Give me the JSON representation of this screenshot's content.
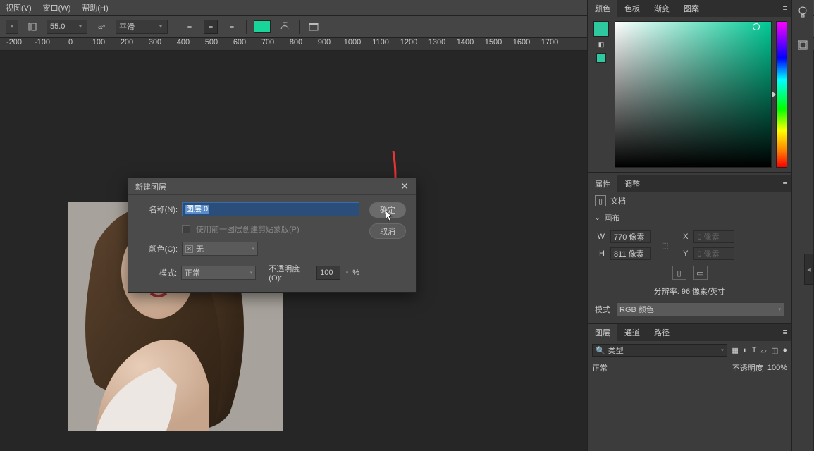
{
  "menu": {
    "view": "视图(V)",
    "window": "窗口(W)",
    "help": "帮助(H)"
  },
  "optbar": {
    "font_size": "55.0",
    "aa_mode": "平滑",
    "color": "#18d59a"
  },
  "ruler": [
    "-200",
    "-100",
    "0",
    "100",
    "200",
    "300",
    "400",
    "500",
    "600",
    "700",
    "800",
    "900",
    "1000",
    "1100",
    "1200",
    "1300",
    "1400",
    "1500",
    "1600",
    "1700"
  ],
  "dialog": {
    "title": "新建图层",
    "name_label": "名称(N):",
    "name_value": "图层 0",
    "clip_label": "使用前一图层创建剪贴蒙版(P)",
    "color_label": "颜色(C):",
    "color_value": "无",
    "mode_label": "模式:",
    "mode_value": "正常",
    "opacity_label": "不透明度(O):",
    "opacity_value": "100",
    "opacity_unit": "%",
    "ok": "确定",
    "cancel": "取消"
  },
  "panels": {
    "color_tabs": {
      "color": "颜色",
      "swatches": "色板",
      "gradient": "渐变",
      "pattern": "图案"
    },
    "prop_tabs": {
      "properties": "属性",
      "adjust": "调整"
    },
    "doc_label": "文档",
    "canvas_section": "画布",
    "W": "W",
    "H": "H",
    "X": "X",
    "Y": "Y",
    "w_val": "770 像素",
    "h_val": "811 像素",
    "x_val": "0 像素",
    "y_val": "0 像素",
    "res": "分辨率: 96 像素/英寸",
    "mode_l": "模式",
    "mode_v": "RGB 颜色",
    "layer_tabs": {
      "layers": "图层",
      "channels": "通道",
      "paths": "路径"
    },
    "layersearch_ph": "类型",
    "blend": "正常",
    "opacity_l": "不透明度",
    "opacity_v": "100%"
  },
  "colors": {
    "current": "#2fc9a0",
    "accent": "#18d59a"
  }
}
